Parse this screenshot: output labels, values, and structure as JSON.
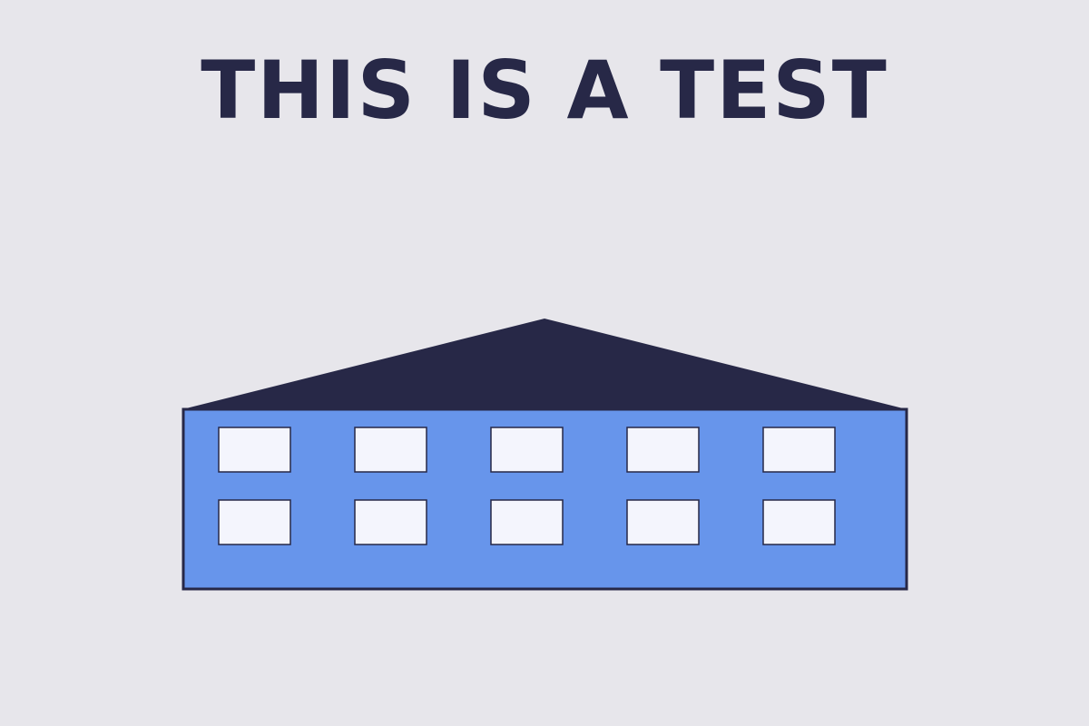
{
  "headline": "THIS IS A TEST",
  "colors": {
    "background": "#e7e6eb",
    "ink": "#272847",
    "building_wall": "#6795eb",
    "window_fill": "#f4f5fd"
  },
  "illustration": {
    "subject": "building",
    "window_rows": 2,
    "windows_per_row": 5
  }
}
